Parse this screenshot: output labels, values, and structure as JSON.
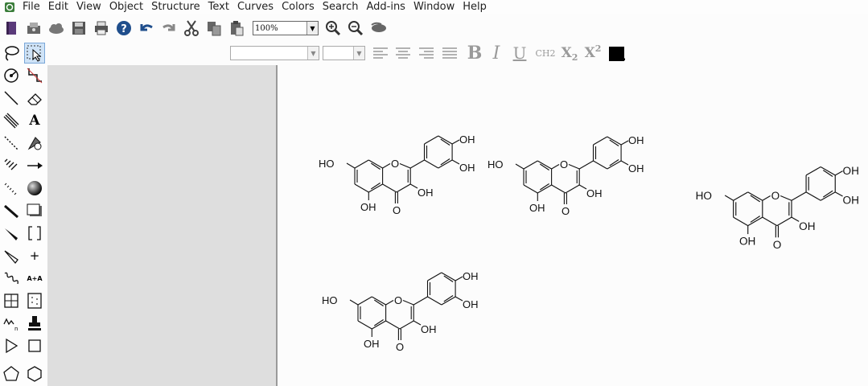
{
  "menubar": {
    "items": [
      "File",
      "Edit",
      "View",
      "Object",
      "Structure",
      "Text",
      "Curves",
      "Colors",
      "Search",
      "Add-ins",
      "Window",
      "Help"
    ]
  },
  "toolbar": {
    "zoom_value": "100%",
    "buttons": [
      "new-document-icon",
      "open-icon",
      "cloud-icon",
      "save-icon",
      "print-icon",
      "help-icon",
      "undo-icon",
      "redo-icon",
      "cut-icon",
      "copy-icon",
      "paste-icon",
      "zoom-in-icon",
      "zoom-out-icon",
      "hide-icon"
    ]
  },
  "format": {
    "bold": "B",
    "italic": "I",
    "underline": "U",
    "ch2": "CH2",
    "sub_base": "X",
    "sub": "2",
    "sup_base": "X",
    "sup": "2",
    "color": "#000000"
  },
  "palette": {
    "text_tool": "A",
    "plus_tool": "+",
    "rename_tool": "A+A",
    "orbital_n": "n"
  },
  "molecule": {
    "labels": {
      "ho_left": "HO",
      "o_ring": "O",
      "oh_top": "OH",
      "oh_mid": "OH",
      "oh_3": "OH",
      "oh_5": "OH",
      "o_carbonyl": "O"
    }
  },
  "colors": {
    "workspace": "#dedede",
    "canvas": "#fcfcfc",
    "selected_tool": "#cfe3f7"
  }
}
